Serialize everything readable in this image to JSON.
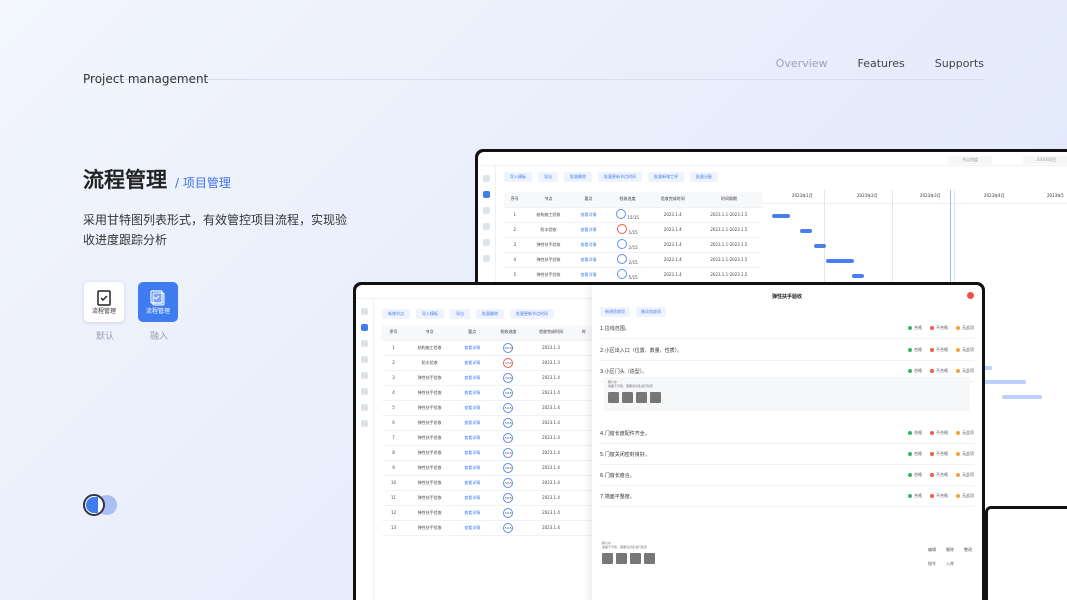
{
  "header": {
    "brand": "Project management",
    "nav": [
      "Overview",
      "Features",
      "Supports"
    ]
  },
  "hero": {
    "title": "流程管理",
    "subtitle": "/ 项目管理",
    "description": "采用甘特图列表形式，有效管控项目流程，实现验收进度跟踪分析"
  },
  "modes": [
    {
      "label": "默认",
      "button_text": "流程管理"
    },
    {
      "label": "融入",
      "button_text": "流程管理"
    }
  ],
  "back_screen": {
    "toolbar": [
      "导入模板",
      "导出",
      "批量删除",
      "批量更新节点时间",
      "批量新增工序",
      "批量分配"
    ],
    "select_value": "节点进度",
    "search_value": "XXXX项目",
    "columns": [
      "序号",
      "节点",
      "要点",
      "检收进度",
      "验收完成时间",
      "时间周期"
    ],
    "rows": [
      {
        "no": "1",
        "node": "结构施工验收",
        "point": "查看详情",
        "progress": "15/15",
        "date": "2023.1.4",
        "span": "2023.1.1-2023.1.5"
      },
      {
        "no": "2",
        "node": "防水验收",
        "point": "查看详情",
        "progress": "1/15",
        "date": "2023.1.4",
        "span": "2023.1.1-2023.1.5"
      },
      {
        "no": "3",
        "node": "弹性扶手验收",
        "point": "查看详情",
        "progress": "2/15",
        "date": "2023.1.4",
        "span": "2023.1.1-2023.1.5"
      },
      {
        "no": "4",
        "node": "弹性扶手验收",
        "point": "查看详情",
        "progress": "2/15",
        "date": "2023.1.4",
        "span": "2023.1.1-2023.1.5"
      },
      {
        "no": "5",
        "node": "弹性扶手验收",
        "point": "查看详情",
        "progress": "5/15",
        "date": "2023.1.4",
        "span": "2023.1.1-2023.1.5"
      }
    ],
    "gantt_months": [
      "2023年1月",
      "2023年2月",
      "2023年3月",
      "2023年4月",
      "2023年5"
    ]
  },
  "front_screen": {
    "toolbar": [
      "新增节点",
      "导入模板",
      "导出",
      "批量删除",
      "批量更新节点时间"
    ],
    "columns": [
      "序号",
      "节点",
      "要点",
      "检收进度",
      "验收完成时间",
      "时"
    ],
    "rows": [
      {
        "no": "1",
        "node": "结构施工验收",
        "point": "查看详情",
        "progress": "15/15",
        "date": "2023.1.3"
      },
      {
        "no": "2",
        "node": "防水验收",
        "point": "查看详情",
        "progress": "1/15",
        "date": "2023.1.3"
      },
      {
        "no": "3",
        "node": "弹性扶手验收",
        "point": "查看详情",
        "progress": "2/15",
        "date": "2023.1.4"
      },
      {
        "no": "4",
        "node": "弹性扶手验收",
        "point": "查看详情",
        "progress": "2/15",
        "date": "2023.1.4"
      },
      {
        "no": "5",
        "node": "弹性扶手验收",
        "point": "查看详情",
        "progress": "5/15",
        "date": "2023.1.4"
      },
      {
        "no": "6",
        "node": "弹性扶手验收",
        "point": "查看详情",
        "progress": "5/15",
        "date": "2023.1.4"
      },
      {
        "no": "7",
        "node": "弹性扶手验收",
        "point": "查看详情",
        "progress": "5/15",
        "date": "2023.1.4"
      },
      {
        "no": "8",
        "node": "弹性扶手验收",
        "point": "查看详情",
        "progress": "5/15",
        "date": "2023.1.4"
      },
      {
        "no": "9",
        "node": "弹性扶手验收",
        "point": "查看详情",
        "progress": "5/15",
        "date": "2023.1.4"
      },
      {
        "no": "10",
        "node": "弹性扶手验收",
        "point": "查看详情",
        "progress": "5/15",
        "date": "2023.1.4"
      },
      {
        "no": "11",
        "node": "弹性扶手验收",
        "point": "查看详情",
        "progress": "5/15",
        "date": "2023.1.4"
      },
      {
        "no": "12",
        "node": "弹性扶手验收",
        "point": "查看详情",
        "progress": "5/15",
        "date": "2023.1.4"
      },
      {
        "no": "13",
        "node": "弹性扶手验收",
        "point": "查看详情",
        "progress": "5/15",
        "date": "2023.1.4"
      }
    ],
    "panel": {
      "title": "弹性扶手验收",
      "buttons": [
        "新增验收项",
        "移动验收项"
      ],
      "questions": [
        "1.拉线范围。",
        "2.小区出入口（位置、数量、性质）。",
        "3.小区门头（造型）。",
        "4.门窗长度配件齐全。",
        "5.门窗关闭密封良好。",
        "6.门窗长度合。",
        "7.墙面平整度。"
      ],
      "options": [
        "合格",
        "不合格",
        "无此项"
      ],
      "note_user": "滕六水",
      "note_text": "墙面不平整，需要请对此进行检查",
      "actions": [
        "编辑",
        "删除",
        "整改",
        "指令",
        "入库"
      ]
    }
  },
  "colors": {
    "accent": "#3f7cf0",
    "danger": "#f0514a",
    "ok": "#36b36b",
    "warn": "#f0a43c"
  }
}
